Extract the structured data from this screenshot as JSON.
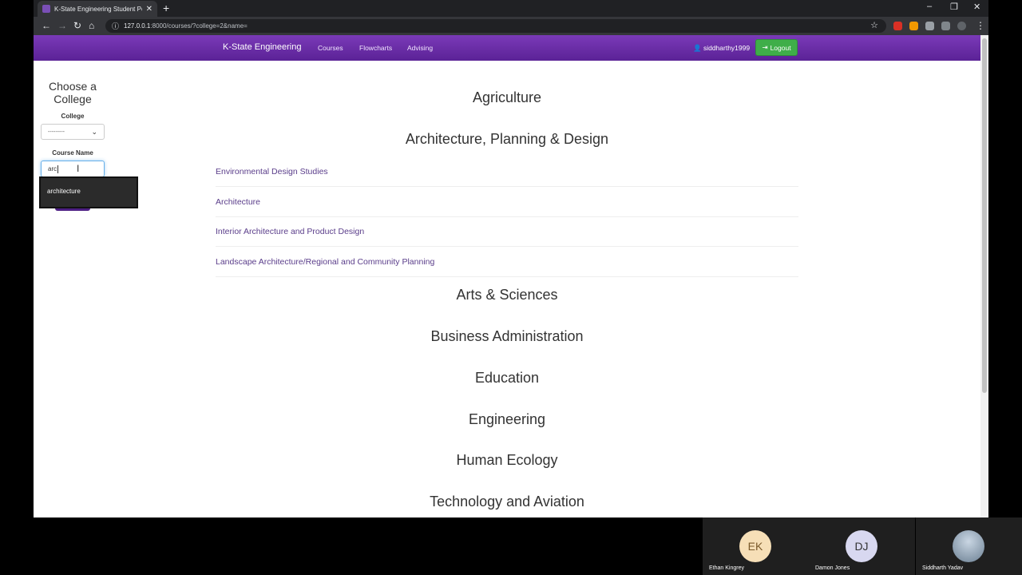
{
  "browser": {
    "tab_title": "K-State Engineering Student Port",
    "tab_close": "✕",
    "new_tab": "+",
    "url_host": "127.0.0.1",
    "url_rest": ":8000/courses/?college=2&name=",
    "window_controls": [
      "–",
      "❐",
      "✕"
    ]
  },
  "navbar": {
    "brand": "K-State Engineering",
    "links": [
      "Courses",
      "Flowcharts",
      "Advising"
    ],
    "user": "siddharthy1999",
    "logout": "Logout",
    "color": "#6a2ea8"
  },
  "sidebar": {
    "title": "Choose a College",
    "college_label": "College",
    "college_value": "---------",
    "course_label": "Course Name",
    "course_value": "arc",
    "autocomplete": [
      "architecture"
    ]
  },
  "main": {
    "colleges": [
      {
        "name": "Agriculture",
        "courses": []
      },
      {
        "name": "Architecture, Planning & Design",
        "courses": [
          "Environmental Design Studies",
          "Architecture",
          "Interior Architecture and Product Design",
          "Landscape Architecture/Regional and Community Planning"
        ]
      },
      {
        "name": "Arts & Sciences",
        "courses": []
      },
      {
        "name": "Business Administration",
        "courses": []
      },
      {
        "name": "Education",
        "courses": []
      },
      {
        "name": "Engineering",
        "courses": []
      },
      {
        "name": "Human Ecology",
        "courses": []
      },
      {
        "name": "Technology and Aviation",
        "courses": []
      }
    ]
  },
  "participants": [
    {
      "initials": "EK",
      "name": "Ethan Kingrey",
      "color": "#f6dfb7"
    },
    {
      "initials": "DJ",
      "name": "Damon Jones",
      "color": "#d8d8f0"
    },
    {
      "initials": "",
      "name": "Siddharth Yadav",
      "color": "#9db4c8"
    }
  ]
}
